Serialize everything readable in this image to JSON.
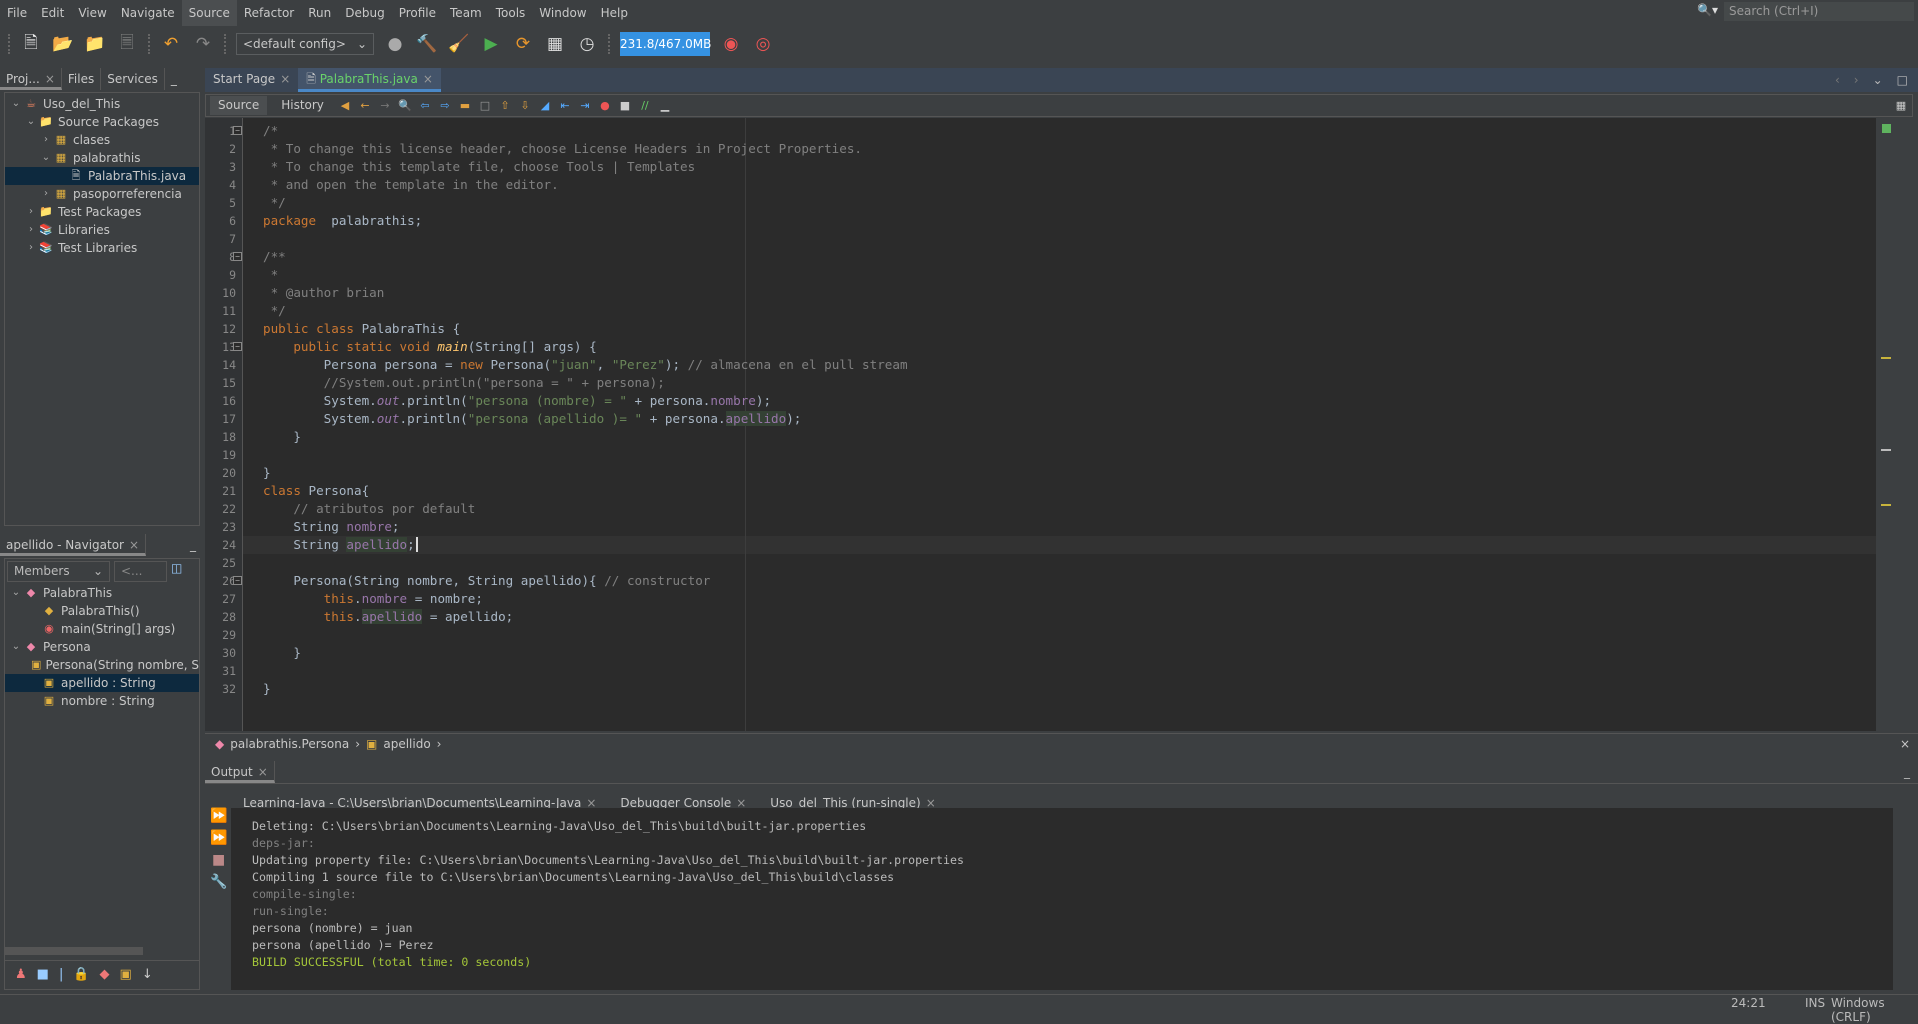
{
  "menu": [
    "File",
    "Edit",
    "View",
    "Navigate",
    "Source",
    "Refactor",
    "Run",
    "Debug",
    "Profile",
    "Team",
    "Tools",
    "Window",
    "Help"
  ],
  "menu_active": "Source",
  "search": {
    "placeholder": "Search (Ctrl+I)"
  },
  "toolbar": {
    "config": "<default config>",
    "memory": "231.8/467.0MB",
    "icons": [
      "new-file-icon",
      "new-project-icon",
      "open-project-icon",
      "close-project-icon",
      "undo-icon",
      "redo-icon",
      "globe-icon",
      "build-hammer-icon",
      "clean-build-icon",
      "run-icon",
      "rerun-icon",
      "debug-icon",
      "profile-icon",
      "gc-icon",
      "gc-target-icon"
    ]
  },
  "left_tabs": [
    "Proj...",
    "Files",
    "Services"
  ],
  "project_tree": [
    {
      "label": "Uso_del_This",
      "depth": 0,
      "exp": "v",
      "icon": "project"
    },
    {
      "label": "Source Packages",
      "depth": 1,
      "exp": "v",
      "icon": "folder"
    },
    {
      "label": "clases",
      "depth": 2,
      "exp": ">",
      "icon": "pkg"
    },
    {
      "label": "palabrathis",
      "depth": 2,
      "exp": "v",
      "icon": "pkg"
    },
    {
      "label": "PalabraThis.java",
      "depth": 3,
      "exp": "",
      "icon": "java",
      "selected": true
    },
    {
      "label": "pasoporreferencia",
      "depth": 2,
      "exp": ">",
      "icon": "pkg"
    },
    {
      "label": "Test Packages",
      "depth": 1,
      "exp": ">",
      "icon": "folder"
    },
    {
      "label": "Libraries",
      "depth": 1,
      "exp": ">",
      "icon": "lib"
    },
    {
      "label": "Test Libraries",
      "depth": 1,
      "exp": ">",
      "icon": "lib"
    }
  ],
  "navigator": {
    "title": "apellido - Navigator",
    "filter": "Members",
    "filter2": "<...",
    "items": [
      {
        "label": "PalabraThis",
        "depth": 0,
        "exp": "v",
        "icon": "class"
      },
      {
        "label": "PalabraThis()",
        "depth": 1,
        "exp": "",
        "icon": "ctor"
      },
      {
        "label": "main(String[] args)",
        "depth": 1,
        "exp": "",
        "icon": "method"
      },
      {
        "label": "Persona",
        "depth": 0,
        "exp": "v",
        "icon": "class"
      },
      {
        "label": "Persona(String nombre, S",
        "depth": 1,
        "exp": "",
        "icon": "ctor2"
      },
      {
        "label": "apellido : String",
        "depth": 1,
        "exp": "",
        "icon": "field",
        "selected": true
      },
      {
        "label": "nombre : String",
        "depth": 1,
        "exp": "",
        "icon": "field"
      }
    ]
  },
  "editor_tabs": [
    {
      "label": "Start Page"
    },
    {
      "label": "PalabraThis.java",
      "selected": true
    }
  ],
  "editor_modes": [
    "Source",
    "History"
  ],
  "code": [
    [
      [
        "cm",
        "/*"
      ]
    ],
    [
      [
        "cm",
        " * To change this license header, choose License Headers in Project Properties."
      ]
    ],
    [
      [
        "cm",
        " * To change this template file, choose Tools | Templates"
      ]
    ],
    [
      [
        "cm",
        " * and open the template in the editor."
      ]
    ],
    [
      [
        "cm",
        " */"
      ]
    ],
    [
      [
        "kw",
        "package"
      ],
      [
        "",
        "  palabrathis;"
      ]
    ],
    [],
    [
      [
        "cm",
        "/**"
      ]
    ],
    [
      [
        "cm",
        " *"
      ]
    ],
    [
      [
        "cm",
        " * @author brian"
      ]
    ],
    [
      [
        "cm",
        " */"
      ]
    ],
    [
      [
        "kw",
        "public class"
      ],
      [
        "",
        " PalabraThis {"
      ]
    ],
    [
      [
        "",
        "    "
      ],
      [
        "kw",
        "public static void"
      ],
      [
        "",
        " "
      ],
      [
        "mth",
        "main"
      ],
      [
        "",
        "(String[] args) {"
      ]
    ],
    [
      [
        "",
        "        Persona persona = "
      ],
      [
        "kw",
        "new"
      ],
      [
        "",
        " Persona("
      ],
      [
        "str",
        "\"juan\""
      ],
      [
        "",
        ", "
      ],
      [
        "str",
        "\"Perez\""
      ],
      [
        "",
        "); "
      ],
      [
        "cm",
        "// almacena en el pull stream"
      ]
    ],
    [
      [
        "cm",
        "        //System.out.println(\"persona = \" + persona);"
      ]
    ],
    [
      [
        "",
        "        System."
      ],
      [
        "st",
        "out"
      ],
      [
        "",
        ".println("
      ],
      [
        "str",
        "\"persona (nombre) = \""
      ],
      [
        "",
        " + persona."
      ],
      [
        "fld",
        "nombre"
      ],
      [
        "",
        ");"
      ]
    ],
    [
      [
        "",
        "        System."
      ],
      [
        "st",
        "out"
      ],
      [
        "",
        ".println("
      ],
      [
        "str",
        "\"persona (apellido )= \""
      ],
      [
        "",
        " + persona."
      ],
      [
        "fld mark",
        "apellido"
      ],
      [
        "",
        ");"
      ]
    ],
    [
      [
        "",
        "    }"
      ]
    ],
    [],
    [
      [
        "",
        "}"
      ]
    ],
    [
      [
        "kw",
        "class"
      ],
      [
        "",
        " Persona{"
      ]
    ],
    [
      [
        "cm",
        "    // atributos por default"
      ]
    ],
    [
      [
        "",
        "    String "
      ],
      [
        "fld",
        "nombre"
      ],
      [
        "",
        ";"
      ]
    ],
    [
      [
        "",
        "    String "
      ],
      [
        "fld mark",
        "apellido"
      ],
      [
        "",
        ";"
      ]
    ],
    [],
    [
      [
        "",
        "    Persona(String nombre, String apellido){ "
      ],
      [
        "cm",
        "// constructor"
      ]
    ],
    [
      [
        "",
        "        "
      ],
      [
        "kw",
        "this"
      ],
      [
        "",
        "."
      ],
      [
        "fld",
        "nombre"
      ],
      [
        "",
        " = nombre;"
      ]
    ],
    [
      [
        "",
        "        "
      ],
      [
        "kw",
        "this"
      ],
      [
        "",
        "."
      ],
      [
        "fld mark",
        "apellido"
      ],
      [
        "",
        " = apellido;"
      ]
    ],
    [],
    [
      [
        "",
        "    }"
      ]
    ],
    [],
    [
      [
        "",
        "}"
      ]
    ]
  ],
  "current_line": 24,
  "fold_lines": [
    1,
    8,
    13,
    26
  ],
  "breadcrumb": [
    "palabrathis.Persona",
    "apellido"
  ],
  "output": {
    "title": "Output",
    "tabs": [
      {
        "label": "Learning-Java - C:\\Users\\brian\\Documents\\Learning-Java"
      },
      {
        "label": "Debugger Console"
      },
      {
        "label": "Uso_del_This (run-single)",
        "selected": true
      }
    ],
    "lines": [
      {
        "t": "Deleting: C:\\Users\\brian\\Documents\\Learning-Java\\Uso_del_This\\build\\built-jar.properties",
        "s": ""
      },
      {
        "t": "deps-jar:",
        "s": "dim"
      },
      {
        "t": "Updating property file: C:\\Users\\brian\\Documents\\Learning-Java\\Uso_del_This\\build\\built-jar.properties",
        "s": ""
      },
      {
        "t": "Compiling 1 source file to C:\\Users\\brian\\Documents\\Learning-Java\\Uso_del_This\\build\\classes",
        "s": ""
      },
      {
        "t": "compile-single:",
        "s": "dim"
      },
      {
        "t": "run-single:",
        "s": "dim"
      },
      {
        "t": "persona (nombre) = juan",
        "s": ""
      },
      {
        "t": "persona (apellido )= Perez",
        "s": ""
      },
      {
        "t": "BUILD SUCCESSFUL (total time: 0 seconds)",
        "s": "ok"
      }
    ]
  },
  "status": {
    "position": "24:21",
    "mode": "INS",
    "line_endings": "Windows (CRLF)"
  }
}
